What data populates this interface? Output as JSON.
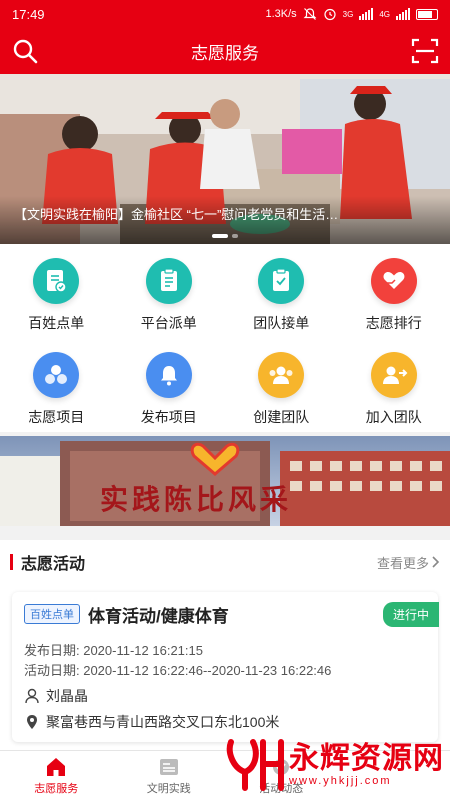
{
  "status_bar": {
    "time": "17:49",
    "speed": "1.3K/s",
    "network_a": "3G",
    "network_b": "4G"
  },
  "header": {
    "title": "志愿服务",
    "search_icon": "search-icon",
    "scan_icon": "scan-icon"
  },
  "banner": {
    "caption": "【文明实践在榆阳】金榆社区 “七一”慰问老党员和生活…",
    "slide_count": 2,
    "active_slide": 1
  },
  "menu": {
    "items": [
      {
        "label": "百姓点单",
        "icon": "order-doc-icon",
        "color": "#1fbdb0"
      },
      {
        "label": "平台派单",
        "icon": "dispatch-doc-icon",
        "color": "#1fbdb0"
      },
      {
        "label": "团队接单",
        "icon": "accept-doc-icon",
        "color": "#1fbdb0"
      },
      {
        "label": "志愿排行",
        "icon": "heart-hand-icon",
        "color": "#f2413c"
      },
      {
        "label": "志愿项目",
        "icon": "project-circles-icon",
        "color": "#4a8ef0"
      },
      {
        "label": "发布项目",
        "icon": "bell-icon",
        "color": "#4a8ef0"
      },
      {
        "label": "创建团队",
        "icon": "group-icon",
        "color": "#f7b52c"
      },
      {
        "label": "加入团队",
        "icon": "join-team-icon",
        "color": "#f7b52c"
      }
    ]
  },
  "promo": {
    "text": "实践陈比风采"
  },
  "activities": {
    "title": "志愿活动",
    "more_label": "查看更多",
    "card": {
      "tag": "百姓点单",
      "title": "体育活动/健康体育",
      "status": "进行中",
      "publish_date": "发布日期: 2020-11-12 16:21:15",
      "activity_date": "活动日期: 2020-11-12 16:22:46--2020-11-23 16:22:46",
      "person": "刘晶晶",
      "address": "聚富巷西与青山西路交叉口东北100米"
    }
  },
  "tabbar": {
    "tabs": [
      {
        "label": "志愿服务",
        "active": true
      },
      {
        "label": "文明实践",
        "active": false
      },
      {
        "label": "活动动态",
        "active": false
      }
    ]
  },
  "watermark": {
    "title": "永辉资源网",
    "url": "www.yhkjjj.com"
  },
  "colors": {
    "brand_red": "#e60012",
    "status_green": "#2bb673",
    "tag_blue": "#3a7bd5"
  }
}
